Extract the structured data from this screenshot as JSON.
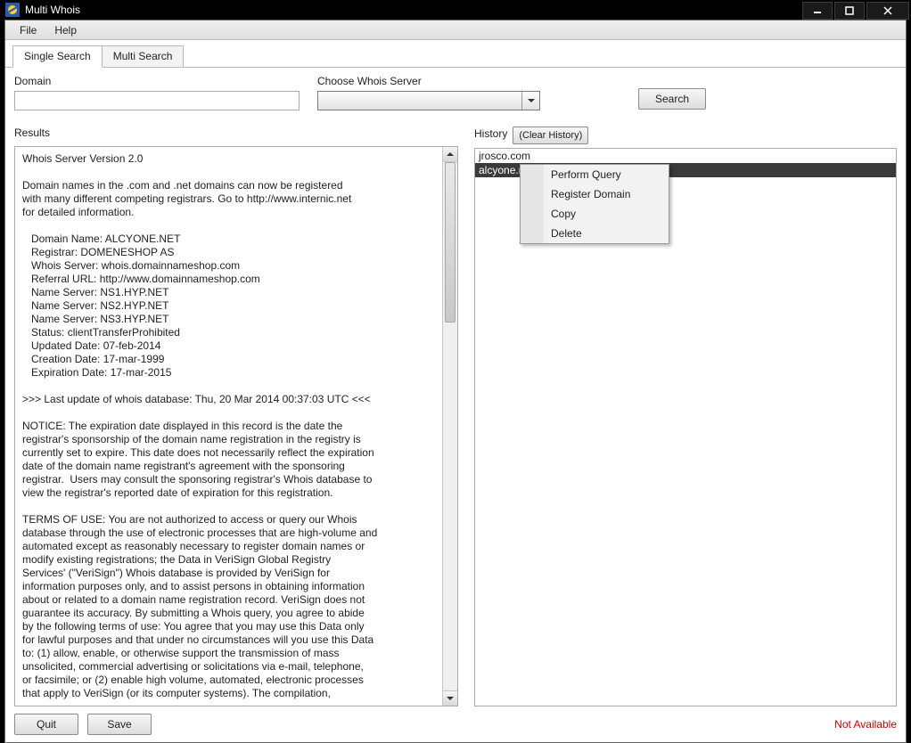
{
  "window": {
    "title": "Multi Whois"
  },
  "menu": {
    "file": "File",
    "help": "Help"
  },
  "tabs": {
    "single": "Single Search",
    "multi": "Multi Search"
  },
  "fields": {
    "domain_label": "Domain",
    "domain_value": "",
    "server_label": "Choose Whois Server",
    "server_value": "",
    "search_btn": "Search"
  },
  "labels": {
    "results": "Results",
    "history": "History",
    "clear_history": "(Clear History)"
  },
  "history": {
    "items": [
      "jrosco.com",
      "alcyone.net"
    ],
    "selected_index": 1
  },
  "context_menu": {
    "items": [
      "Perform Query",
      "Register Domain",
      "Copy",
      "Delete"
    ]
  },
  "footer": {
    "quit": "Quit",
    "save": "Save",
    "status": "Not Available"
  },
  "results_text": "Whois Server Version 2.0\n\nDomain names in the .com and .net domains can now be registered\nwith many different competing registrars. Go to http://www.internic.net\nfor detailed information.\n\n   Domain Name: ALCYONE.NET\n   Registrar: DOMENESHOP AS\n   Whois Server: whois.domainnameshop.com\n   Referral URL: http://www.domainnameshop.com\n   Name Server: NS1.HYP.NET\n   Name Server: NS2.HYP.NET\n   Name Server: NS3.HYP.NET\n   Status: clientTransferProhibited\n   Updated Date: 07-feb-2014\n   Creation Date: 17-mar-1999\n   Expiration Date: 17-mar-2015\n\n>>> Last update of whois database: Thu, 20 Mar 2014 00:37:03 UTC <<<\n\nNOTICE: The expiration date displayed in this record is the date the\nregistrar's sponsorship of the domain name registration in the registry is\ncurrently set to expire. This date does not necessarily reflect the expiration\ndate of the domain name registrant's agreement with the sponsoring\nregistrar.  Users may consult the sponsoring registrar's Whois database to\nview the registrar's reported date of expiration for this registration.\n\nTERMS OF USE: You are not authorized to access or query our Whois\ndatabase through the use of electronic processes that are high-volume and\nautomated except as reasonably necessary to register domain names or\nmodify existing registrations; the Data in VeriSign Global Registry\nServices' (\"VeriSign\") Whois database is provided by VeriSign for\ninformation purposes only, and to assist persons in obtaining information\nabout or related to a domain name registration record. VeriSign does not\nguarantee its accuracy. By submitting a Whois query, you agree to abide\nby the following terms of use: You agree that you may use this Data only\nfor lawful purposes and that under no circumstances will you use this Data\nto: (1) allow, enable, or otherwise support the transmission of mass\nunsolicited, commercial advertising or solicitations via e-mail, telephone,\nor facsimile; or (2) enable high volume, automated, electronic processes\nthat apply to VeriSign (or its computer systems). The compilation,"
}
